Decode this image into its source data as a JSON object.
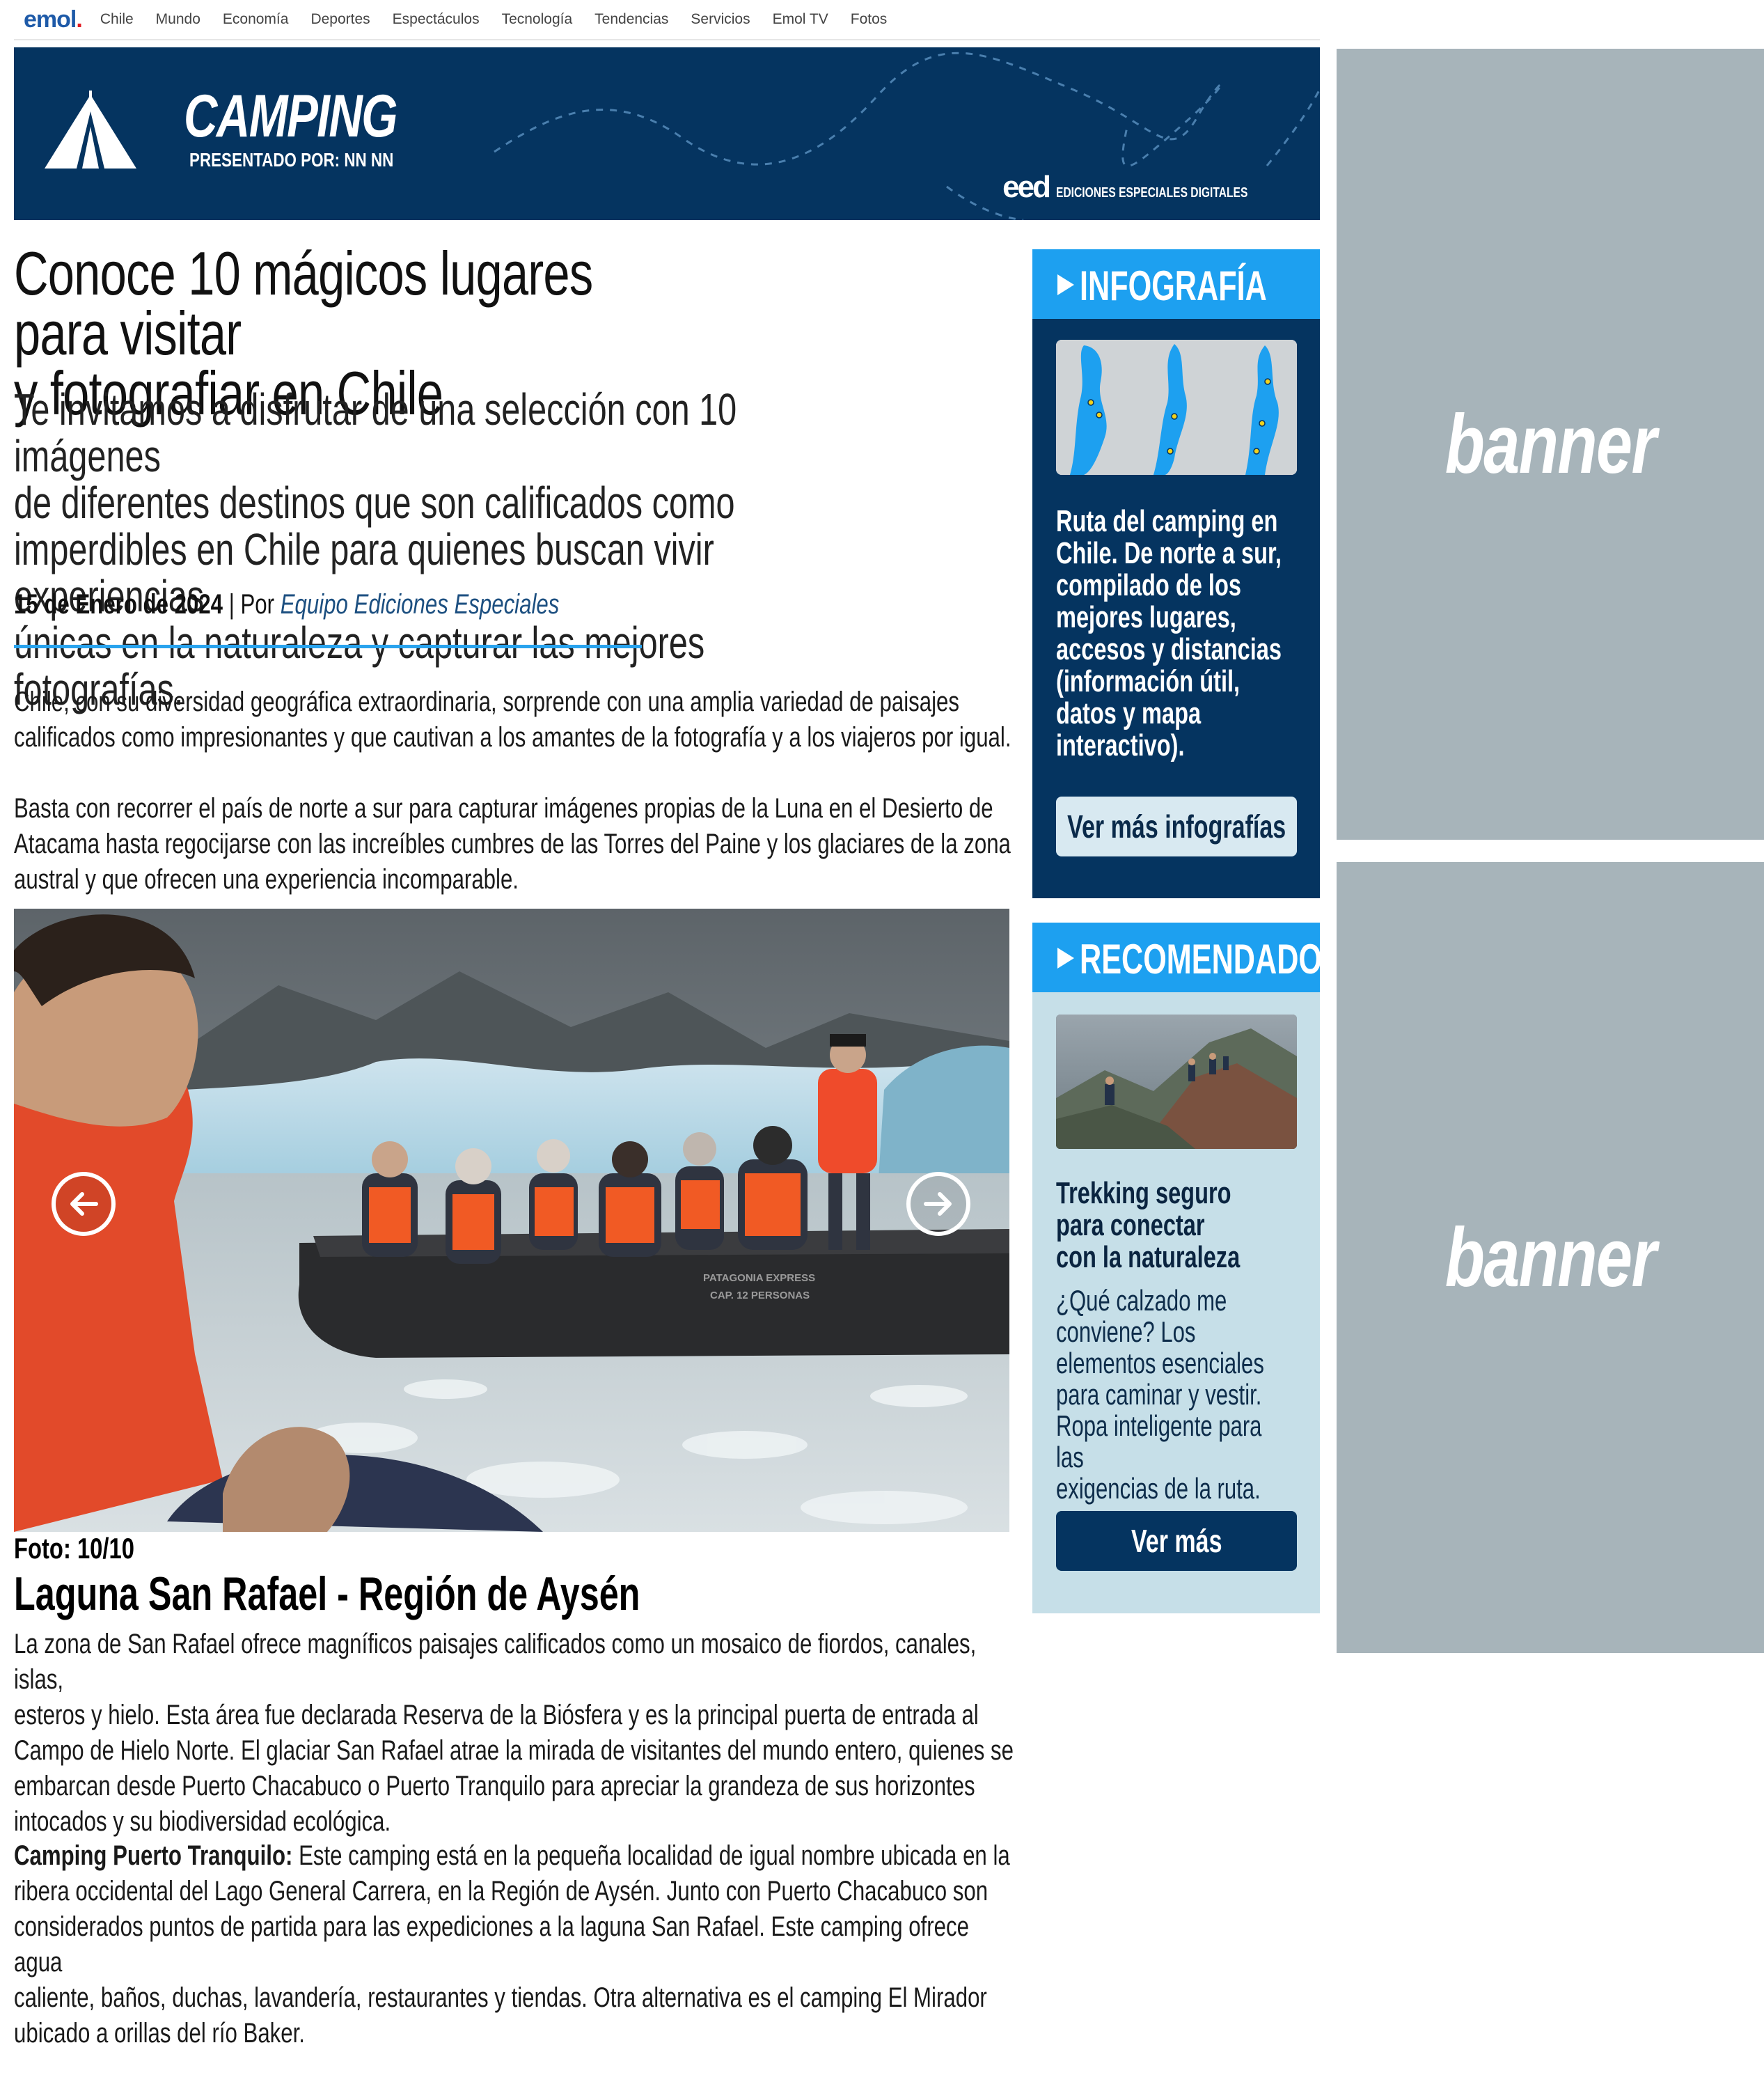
{
  "nav": {
    "logo": "emol",
    "logo_dot": ".",
    "items": [
      "Chile",
      "Mundo",
      "Economía",
      "Deportes",
      "Espectáculos",
      "Tecnología",
      "Tendencias",
      "Servicios",
      "Emol TV",
      "Fotos"
    ]
  },
  "hero": {
    "title": "CAMPING",
    "presented_by": "PRESENTADO POR: NN NN",
    "brand_short": "eed",
    "brand_long": "EDICIONES ESPECIALES DIGITALES"
  },
  "article": {
    "title_line1": "Conoce 10 mágicos lugares para visitar",
    "title_line2": "y fotografiar en Chile",
    "subtitle_lines": [
      "Te invitamos a disfrutar de una selección con 10 imágenes",
      "de diferentes destinos que son calificados como",
      "imperdibles en Chile para quienes buscan vivir experiencias",
      "únicas en la naturaleza y capturar las mejores fotografías."
    ],
    "date": "15 de Enero de 2024",
    "separator": " | Por ",
    "author": "Equipo Ediciones Especiales",
    "paragraphs": [
      [
        "Chile, con su diversidad geográfica extraordinaria, sorprende con una amplia variedad de paisajes",
        "calificados como impresionantes y que cautivan a los amantes de la fotografía y a los viajeros por igual."
      ],
      [
        "Basta con recorrer el país de norte a sur para capturar imágenes propias de la Luna en el Desierto de",
        "Atacama hasta regocijarse con las increíbles cumbres de las Torres del Paine y los glaciares de la zona",
        "austral y que ofrecen una experiencia incomparable."
      ]
    ]
  },
  "gallery": {
    "photo_counter": "Foto: 10/10",
    "caption_title": "Laguna San Rafael - Región de Aysén",
    "boat_text_1": "PATAGONIA EXPRESS",
    "boat_text_2": "CAP. 12 PERSONAS",
    "description_lines": [
      "La zona de San Rafael ofrece magníficos paisajes calificados como un mosaico de fiordos, canales, islas,",
      "esteros y hielo. Esta área fue declarada Reserva de la Biósfera y es la principal puerta de entrada al",
      "Campo de Hielo Norte. El glaciar San Rafael atrae la mirada de visitantes del mundo entero, quienes se",
      "embarcan desde Puerto Chacabuco o Puerto Tranquilo para apreciar la grandeza de sus horizontes",
      "intocados y su biodiversidad ecológica."
    ],
    "camping_label": "Camping Puerto Tranquilo:",
    "camping_lines": [
      " Este camping está en la pequeña localidad de igual nombre ubicada en la",
      "ribera occidental del Lago General Carrera, en la Región de Aysén. Junto con Puerto Chacabuco son",
      "considerados puntos de partida para las expediciones a la laguna San Rafael. Este camping ofrece agua",
      "caliente, baños, duchas, lavandería, restaurantes y tiendas. Otra alternativa es el camping El Mirador",
      "ubicado a orillas del río Baker."
    ]
  },
  "infografia": {
    "header": "INFOGRAFÍA",
    "text_lines": [
      "Ruta del camping en",
      "Chile. De norte a sur,",
      "compilado de los",
      "mejores lugares,",
      "accesos y distancias",
      "(información útil,",
      "datos y mapa",
      "interactivo)."
    ],
    "button": "Ver más infografías"
  },
  "recomendado": {
    "header": "RECOMENDADO",
    "title_lines": [
      "Trekking seguro",
      "para conectar",
      "con la naturaleza"
    ],
    "body_lines": [
      "¿Qué calzado me",
      "conviene? Los",
      "elementos esenciales",
      "para caminar y vestir.",
      "Ropa inteligente para las",
      "exigencias de la ruta."
    ],
    "button": "Ver más"
  },
  "banners": [
    "banner",
    "banner"
  ],
  "colors": {
    "navy": "#053460",
    "accent_blue": "#1da0f0",
    "light_blue_box": "#c6dfe8",
    "banner_gray": "#a7b4ba",
    "emol_blue": "#1e5aa8",
    "emol_red": "#e21b22"
  }
}
